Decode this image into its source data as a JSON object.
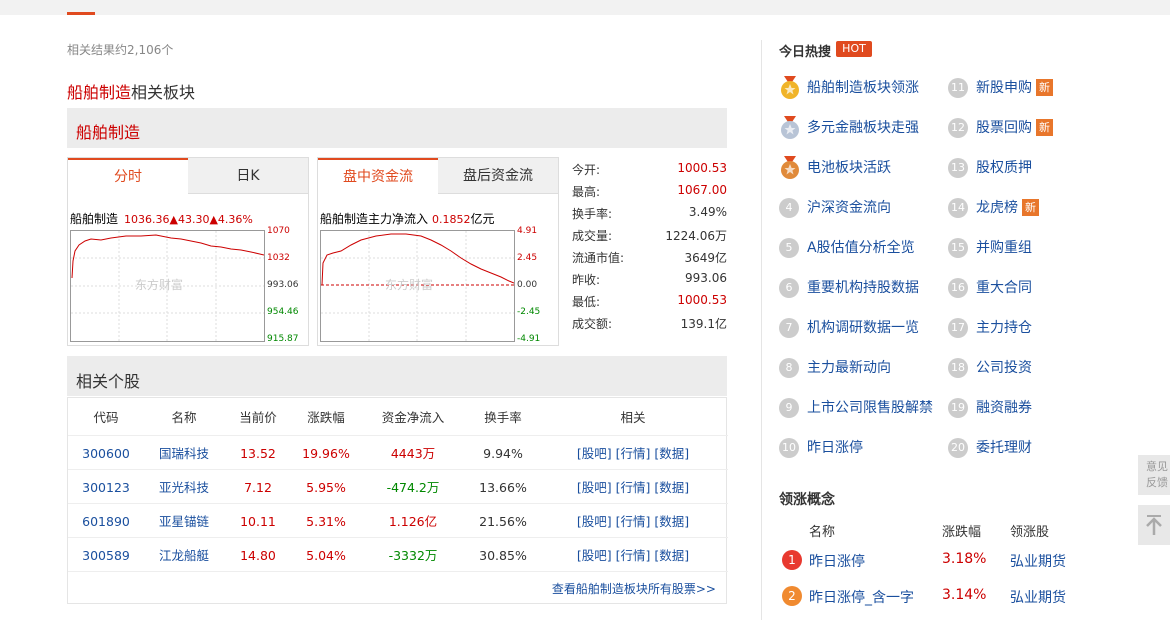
{
  "search": {
    "result_count": "相关结果约2,106个"
  },
  "section": {
    "name": "船舶制造",
    "suffix": "相关板块"
  },
  "panel": {
    "title": "船舶制造"
  },
  "chart_tabs": {
    "fenshi": "分时",
    "rik": "日K"
  },
  "flow_tabs": {
    "intraday": "盘中资金流",
    "after": "盘后资金流"
  },
  "price_chart": {
    "label": "船舶制造",
    "value": "1036.36▲43.30▲4.36%",
    "axis": [
      "1070",
      "1032",
      "993.06",
      "954.46",
      "915.87"
    ],
    "watermark": "东方财富"
  },
  "flow_chart": {
    "label_pre": "船舶制造主力净流入",
    "value": "0.1852",
    "unit": "亿元",
    "axis": [
      "4.91",
      "2.45",
      "0.00",
      "-2.45",
      "-4.91"
    ],
    "watermark": "东方财富"
  },
  "stats": [
    {
      "k": "今开:",
      "v": "1000.53",
      "color": "#cc0000"
    },
    {
      "k": "最高:",
      "v": "1067.00",
      "color": "#cc0000"
    },
    {
      "k": "换手率:",
      "v": "3.49%",
      "color": "#333333"
    },
    {
      "k": "成交量:",
      "v": "1224.06万",
      "color": "#333333"
    },
    {
      "k": "流通市值:",
      "v": "3649亿",
      "color": "#333333"
    },
    {
      "k": "昨收:",
      "v": "993.06",
      "color": "#333333"
    },
    {
      "k": "最低:",
      "v": "1000.53",
      "color": "#cc0000"
    },
    {
      "k": "成交额:",
      "v": "139.1亿",
      "color": "#333333"
    }
  ],
  "stocks": {
    "title": "相关个股",
    "headers": [
      "代码",
      "名称",
      "当前价",
      "涨跌幅",
      "资金净流入",
      "换手率",
      "相关"
    ],
    "rows": [
      {
        "code": "300600",
        "name": "国瑞科技",
        "price": "13.52",
        "chg": "19.96%",
        "flow": "4443万",
        "flow_dir": "up",
        "turnover": "9.94%"
      },
      {
        "code": "300123",
        "name": "亚光科技",
        "price": "7.12",
        "chg": "5.95%",
        "flow": "-474.2万",
        "flow_dir": "down",
        "turnover": "13.66%"
      },
      {
        "code": "601890",
        "name": "亚星锚链",
        "price": "10.11",
        "chg": "5.31%",
        "flow": "1.126亿",
        "flow_dir": "up",
        "turnover": "21.56%"
      },
      {
        "code": "300589",
        "name": "江龙船艇",
        "price": "14.80",
        "chg": "5.04%",
        "flow": "-3332万",
        "flow_dir": "down",
        "turnover": "30.85%"
      }
    ],
    "links": [
      "[股吧]",
      "[行情]",
      "[数据]"
    ],
    "more": "查看船舶制造板块所有股票>>"
  },
  "hot": {
    "title": "今日热搜",
    "badge": "HOT",
    "new_label": "新",
    "items": [
      {
        "n": "1",
        "text": "船舶制造板块领涨",
        "medal": "gold"
      },
      {
        "n": "2",
        "text": "多元金融板块走强",
        "medal": "silver"
      },
      {
        "n": "3",
        "text": "电池板块活跃",
        "medal": "bronze"
      },
      {
        "n": "4",
        "text": "沪深资金流向"
      },
      {
        "n": "5",
        "text": "A股估值分析全览"
      },
      {
        "n": "6",
        "text": "重要机构持股数据"
      },
      {
        "n": "7",
        "text": "机构调研数据一览"
      },
      {
        "n": "8",
        "text": "主力最新动向"
      },
      {
        "n": "9",
        "text": "上市公司限售股解禁"
      },
      {
        "n": "10",
        "text": "昨日涨停"
      },
      {
        "n": "11",
        "text": "新股申购",
        "new": true
      },
      {
        "n": "12",
        "text": "股票回购",
        "new": true
      },
      {
        "n": "13",
        "text": "股权质押"
      },
      {
        "n": "14",
        "text": "龙虎榜",
        "new": true
      },
      {
        "n": "15",
        "text": "并购重组"
      },
      {
        "n": "16",
        "text": "重大合同"
      },
      {
        "n": "17",
        "text": "主力持仓"
      },
      {
        "n": "18",
        "text": "公司投资"
      },
      {
        "n": "19",
        "text": "融资融券"
      },
      {
        "n": "20",
        "text": "委托理财"
      }
    ]
  },
  "leading": {
    "title": "领涨概念",
    "headers": [
      "名称",
      "涨跌幅",
      "领涨股"
    ],
    "rows": [
      {
        "n": "1",
        "name": "昨日涨停",
        "chg": "3.18%",
        "stock": "弘业期货",
        "color": "#e8392f"
      },
      {
        "n": "2",
        "name": "昨日涨停_含一字",
        "chg": "3.14%",
        "stock": "弘业期货",
        "color": "#f08a30"
      }
    ]
  },
  "side": {
    "feedback": "意见反馈"
  }
}
